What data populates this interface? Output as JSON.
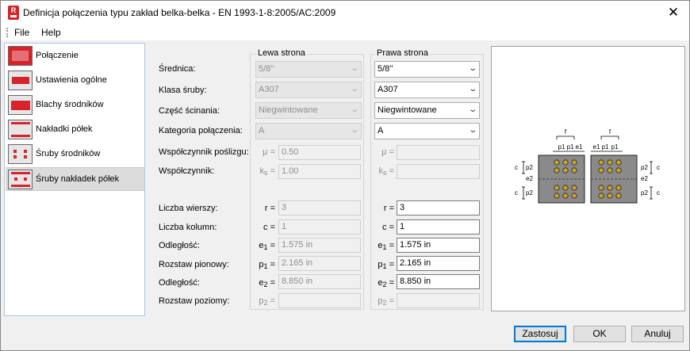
{
  "window": {
    "title": "Definicja połączenia typu zakład belka-belka - EN 1993-1-8:2005/AC:2009",
    "app_icon_letter": "R"
  },
  "menu": {
    "items": [
      "File",
      "Help"
    ]
  },
  "sidebar": {
    "items": [
      {
        "label": "Połączenie",
        "icon": "connection-icon"
      },
      {
        "label": "Ustawienia ogólne",
        "icon": "general-settings-icon"
      },
      {
        "label": "Blachy środników",
        "icon": "web-plates-icon"
      },
      {
        "label": "Nakładki półek",
        "icon": "flange-plates-icon"
      },
      {
        "label": "Śruby środników",
        "icon": "web-bolts-icon"
      },
      {
        "label": "Śruby nakładek półek",
        "icon": "flange-bolts-icon"
      }
    ],
    "active_index": 5
  },
  "form": {
    "left_group": "Lewa strona",
    "right_group": "Prawa strona",
    "labels": {
      "diameter": "Średnica:",
      "bolt_class": "Klasa śruby:",
      "shear_part": "Część ścinania:",
      "category": "Kategoria połączenia:",
      "slip_factor": "Współczynnik poślizgu:",
      "factor": "Współczynnik:",
      "rows": "Liczba wierszy:",
      "columns": "Liczba kolumn:",
      "distance1": "Odległość:",
      "vertical_spacing": "Rozstaw pionowy:",
      "distance2": "Odległość:",
      "horizontal_spacing": "Rozstaw poziomy:"
    },
    "symbols": {
      "mu": "μ =",
      "k": "k",
      "k_sub": "s",
      "r": "r =",
      "c": "c =",
      "e": "e",
      "e1_sub": "1",
      "e2_sub": "2",
      "p": "p",
      "p1_sub": "1",
      "p2_sub": "2",
      "eq": " ="
    },
    "left": {
      "diameter": "5/8''",
      "bolt_class": "A307",
      "shear_part": "Niegwintowane",
      "category": "A",
      "mu": "0.50",
      "ks": "1.00",
      "r": "3",
      "c": "1",
      "e1": "1.575 in",
      "p1": "2.165 in",
      "e2": "8.850 in",
      "p2": ""
    },
    "right": {
      "diameter": "5/8''",
      "bolt_class": "A307",
      "shear_part": "Niegwintowane",
      "category": "A",
      "mu": "",
      "ks": "",
      "r": "3",
      "c": "1",
      "e1": "1.575 in",
      "p1": "2.165 in",
      "e2": "8.850 in",
      "p2": ""
    }
  },
  "diagram": {
    "top_label_f": "f",
    "top_labels": [
      "e1",
      "p1",
      "p1",
      "e1"
    ],
    "left_c": "c",
    "left_p2": "p2",
    "e2": "e2",
    "right_p2": "p2",
    "right_c": "c"
  },
  "buttons": {
    "apply": "Zastosuj",
    "ok": "OK",
    "cancel": "Anuluj"
  }
}
